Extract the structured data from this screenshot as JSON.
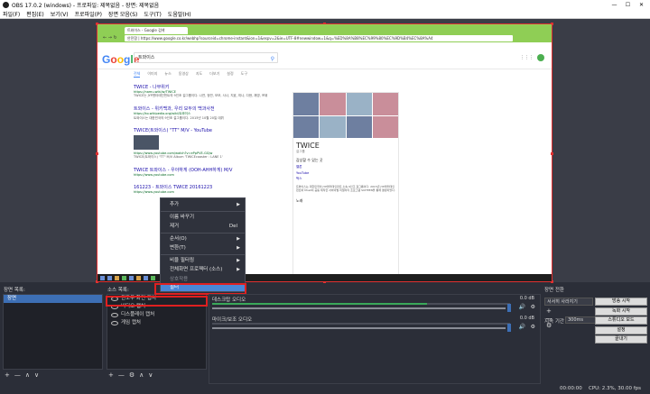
{
  "window": {
    "title": "OBS 17.0.2 (windows) - 프로파일: 제목없음 - 장면: 제목없음",
    "min": "—",
    "max": "☐",
    "close": "✕"
  },
  "menu": [
    "파일(F)",
    "편집(E)",
    "보기(V)",
    "프로파일(P)",
    "장면 모음(S)",
    "도구(T)",
    "도움말(H)"
  ],
  "browser": {
    "tab": "트와이스 - Google 검색",
    "nav": "← → ↻",
    "address": "안전함 | https://www.google.co.kr/webhp?sourceid=chrome-instant&ion=1&espv=2&ie=UTF-8#newwindow=1&q=%ED%8A%B8%EC%99%80%EC%9D%B4%EC%8A%A4",
    "logo": "Google",
    "query": "트와이스",
    "tabs": [
      "전체",
      "이미지",
      "뉴스",
      "동영상",
      "지도",
      "더보기",
      "설정",
      "도구"
    ],
    "results": [
      {
        "title": "TWICE - 나무위키",
        "url": "https://namu.wiki/w/TWICE",
        "text": "TWICE는 JYP엔터테인먼트의 9인조 걸그룹이다. 나연, 정연, 모모, 사나, 지효, 미나, 다현, 채영, 쯔위"
      },
      {
        "title": "트와이스 - 위키백과, 우리 모두의 백과사전",
        "url": "https://ko.wikipedia.org/wiki/트와이스",
        "text": "트와이스는 대한민국의 9인조 걸그룹이다. 2015년 10월 20일 데뷔"
      },
      {
        "title": "TWICE(트와이스) \"TT\" M/V - YouTube",
        "url": "https://www.youtube.com/watch?v=ePpPVE-GGJw",
        "text": "TWICE(트와이스) \"TT\" M/V Album 'TWICEcoaster : LANE 1'"
      },
      {
        "title": "TWICE 트와이스 - 우아하게 (OOH-AHH하게) M/V",
        "url": "https://www.youtube.com",
        "text": ""
      },
      {
        "title": "161223 - 트와이스 TWICE 20161223",
        "url": "https://www.youtube.com",
        "text": ""
      }
    ],
    "knowledge": {
      "title": "TWICE",
      "sub": "걸그룹",
      "section": "감상할 수 있는 곳",
      "links": [
        "멜론",
        "YouTube",
        "벅스"
      ],
      "body": "트와이스는 대한민국의 JYP엔터테인먼트 소속 9인조 걸그룹이다. 2015년 JYP엔터테인먼트와 Mnet이 공동 제작한 서바이벌 리얼리티 프로그램 SIXTEEN을 통해 결성되었다.",
      "more": "노래"
    }
  },
  "context_menu": {
    "items": [
      {
        "label": "추가",
        "arrow": "▶"
      },
      {
        "label": "이름 바꾸기"
      },
      {
        "label": "제거",
        "shortcut": "Del"
      },
      {
        "label": "순서(O)",
        "arrow": "▶"
      },
      {
        "label": "변환(T)",
        "arrow": "▶"
      },
      {
        "label": "비율 필터링",
        "arrow": "▶"
      },
      {
        "label": "전체화면 프로젝터 (소스)",
        "arrow": "▶"
      },
      {
        "label": "상호작용"
      },
      {
        "label": "필터"
      }
    ]
  },
  "docks": {
    "scenes_label": "장면 목록:",
    "sources_label": "소스 목록:",
    "mixer_label": "믹서",
    "transition_label": "장면 전환",
    "scenes": [
      "장면"
    ],
    "sources": [
      "윈도우 화면 캡처",
      "비디오 캡처",
      "디스플레이 캡처",
      "게임 캡처"
    ],
    "toolbar": [
      "+",
      "—",
      "∧",
      "∨"
    ],
    "sources_toolbar": [
      "+",
      "—",
      "⚙",
      "∧",
      "∨"
    ]
  },
  "mixer": [
    {
      "name": "데스크탑 오디오",
      "db": "0.0 dB",
      "level": 0.72
    },
    {
      "name": "마이크/보조 오디오",
      "db": "0.0 dB",
      "level": 0.0
    }
  ],
  "transition": {
    "selected": "서서히 사라지기",
    "tools": "+  —  ⚙",
    "duration_label": "지속 기간",
    "duration": "300ms"
  },
  "controls": [
    "방송 시작",
    "녹화 시작",
    "스튜디오 모드",
    "설정",
    "끝내기"
  ],
  "status": {
    "time": "00:00:00",
    "cpu": "CPU: 2.3%, 30.00 fps"
  }
}
